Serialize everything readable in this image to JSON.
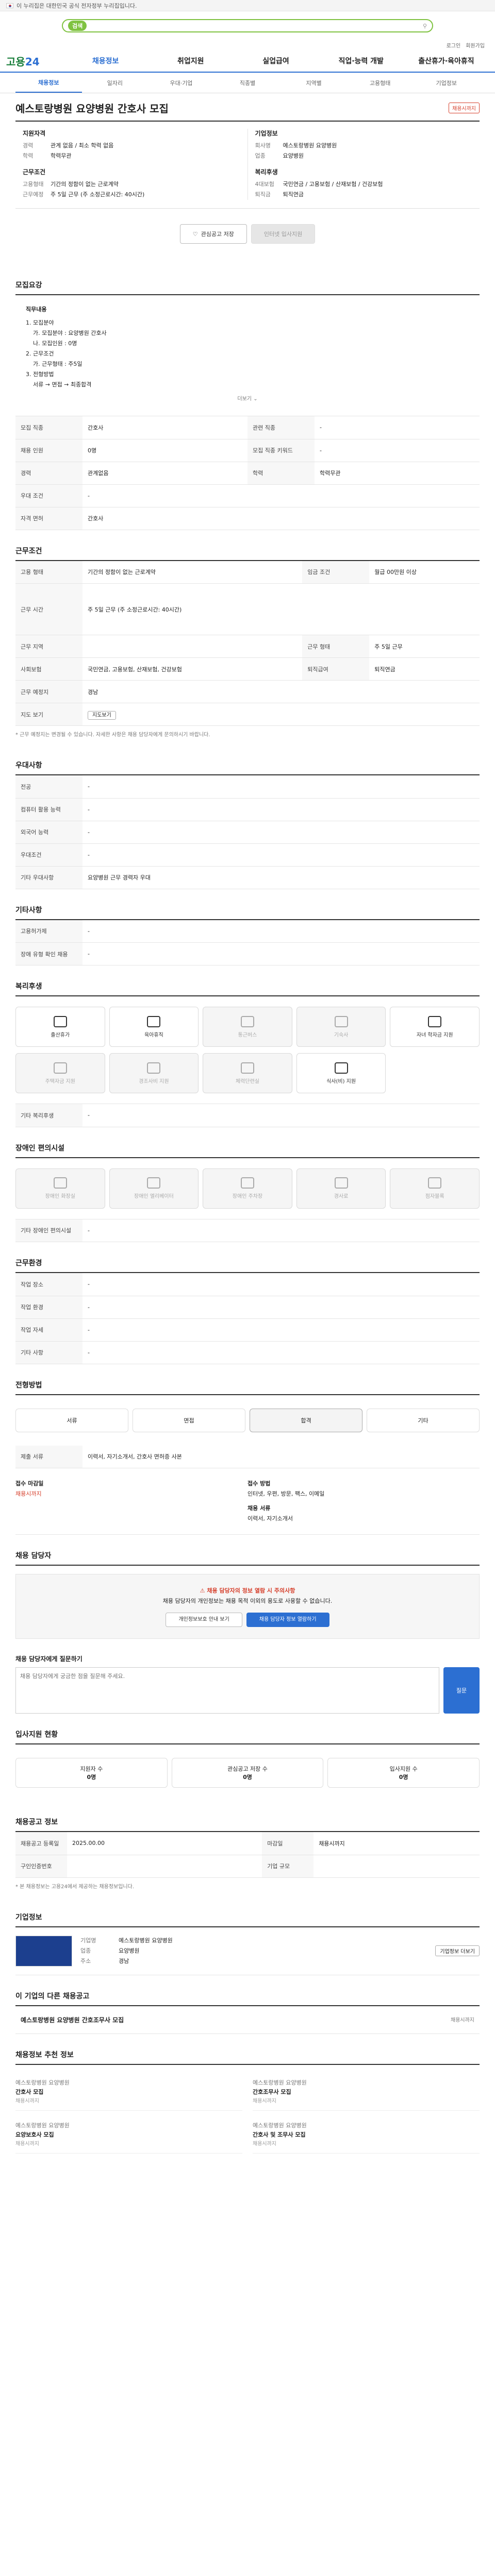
{
  "govbar": {
    "text": "이 누리집은 대한민국 공식 전자정부 누리집입니다."
  },
  "search": {
    "label": "검색",
    "placeholder": ""
  },
  "util": [
    "로그인",
    "회원가입"
  ],
  "gnb": {
    "logo_a": "고용",
    "logo_b": "24",
    "items": [
      "채용정보",
      "취업지원",
      "실업급여",
      "직업·능력 개발",
      "출산휴가·육아휴직"
    ]
  },
  "subnav": [
    "채용정보",
    "일자리",
    "우대·기업",
    "직종별",
    "지역별",
    "고용형태",
    "기업정보"
  ],
  "job": {
    "title": "예스토랑병원 요양병원 간호사 모집",
    "status": "채용시까지"
  },
  "summary": {
    "col1": {
      "h1": "지원자격",
      "kv1": [
        [
          "경력",
          "관계 없음 / 최소 학력 없음"
        ],
        [
          "학력",
          "학력무관"
        ]
      ],
      "h2": "근무조건",
      "kv2": [
        [
          "고용형태",
          "기간의 정함이 없는 근로계약"
        ],
        [
          "근무예정",
          "주 5일 근무 (주 소정근로시간: 40시간)"
        ]
      ]
    },
    "col2": {
      "h1": "기업정보",
      "kv1": [
        [
          "회사명",
          "예스토랑병원 요양병원"
        ],
        [
          "업종",
          "요양병원"
        ],
        [
          "기업규모",
          ""
        ]
      ],
      "h2": "복리후생",
      "kv2": [
        [
          "4대보험",
          "국민연금 / 고용보험 / 산재보험 / 건강보험"
        ],
        [
          "퇴직금",
          "퇴직연금"
        ]
      ]
    }
  },
  "actions": {
    "scrap": "관심공고 저장",
    "apply": "인터넷 입사지원"
  },
  "sections": {
    "duty": {
      "title": "모집요강",
      "heading": "직무내용",
      "lines": [
        "1. 모집분야",
        "가. 모집분야 : 요양병원 간호사",
        "나. 모집인원 : 0명",
        "2. 근무조건",
        "가. 근무형태 : 주5일",
        "3. 전형방법",
        "서류 → 면접 → 최종합격"
      ],
      "more": "더보기"
    },
    "recruit": {
      "rows": [
        [
          "모집 직종",
          "간호사",
          "관련 직종",
          "-"
        ],
        [
          "채용 인원",
          "0명",
          "모집 직종 키워드",
          "-"
        ],
        [
          "경력",
          "관계없음",
          "학력",
          "학력무관"
        ],
        [
          "우대 조건",
          "-",
          "",
          ""
        ],
        [
          "자격 면허",
          "간호사",
          "",
          ""
        ]
      ]
    },
    "work": {
      "title": "근무조건",
      "rows": [
        [
          "고용 형태",
          "기간의 정함이 없는 근로계약",
          "임금 조건",
          "월급 00만원 이상"
        ],
        [
          "근무 시간",
          "주 5일 근무 (주 소정근로시간: 40시간)",
          "",
          ""
        ],
        [
          "근무 지역",
          "",
          "근무 형태",
          "주 5일 근무"
        ],
        [
          "사회보험",
          "국민연금, 고용보험, 산재보험, 건강보험",
          "퇴직급여",
          "퇴직연금"
        ],
        [
          "근무 예정지",
          "경남",
          "",
          ""
        ],
        [
          "지도 보기",
          "지도보기",
          "",
          ""
        ]
      ],
      "note": "* 근무 예정지는 변경될 수 있습니다. 자세한 사항은 채용 담당자에게 문의하시기 바랍니다."
    },
    "welfare": {
      "title": "우대사항",
      "rows": [
        [
          "전공",
          "-"
        ],
        [
          "컴퓨터 활용 능력",
          "-"
        ],
        [
          "외국어 능력",
          "-"
        ],
        [
          "우대조건",
          "-"
        ],
        [
          "기타 우대사항",
          "요양병원 근무 경력자 우대"
        ]
      ]
    },
    "etc": {
      "title": "기타사항",
      "rows": [
        [
          "고용허가제",
          "-"
        ],
        [
          "장애 유형 확인 채용",
          "-"
        ]
      ]
    },
    "benefits": {
      "title": "복리후생",
      "cards": [
        [
          "출산휴가",
          true
        ],
        [
          "육아휴직",
          true
        ],
        [
          "통근버스",
          false
        ],
        [
          "기숙사",
          false
        ],
        [
          "자녀 학자금 지원",
          true
        ],
        [
          "주택자금 지원",
          false
        ],
        [
          "경조사비 지원",
          false
        ],
        [
          "체력단련실",
          false
        ],
        [
          "식사(비) 지원",
          true
        ]
      ],
      "etc_label": "기타 복리후생",
      "etc_value": "-"
    },
    "disabled": {
      "title": "장애인 편의시설",
      "cards": [
        "장애인 화장실",
        "장애인 엘리베이터",
        "장애인 주차장",
        "경사로",
        "점자블록"
      ],
      "etc_label": "기타 장애인 편의시설",
      "etc_value": "-"
    },
    "location": {
      "title": "근무환경",
      "rows": [
        [
          "작업 장소",
          "-",
          "",
          ""
        ],
        [
          "작업 환경",
          "-",
          "",
          ""
        ],
        [
          "작업 자세",
          "-",
          "",
          ""
        ],
        [
          "기타 사항",
          "-",
          "",
          ""
        ]
      ]
    },
    "process": {
      "title": "전형방법",
      "steps": [
        "서류",
        "면접",
        "합격",
        "기타"
      ],
      "on": 2,
      "docs_label": "제출 서류",
      "docs": "이력서, 자기소개서, 간호사 면허증 사본"
    },
    "apply": {
      "c1_h": "접수 마감일",
      "c1_v": "채용시까지",
      "c2_h": "접수 방법",
      "c2_v": "인터넷, 우편, 방문, 팩스, 이메일",
      "c3_h": "채용 서류",
      "c3_v": "이력서, 자기소개서"
    },
    "contact": {
      "title": "채용 담당자",
      "warn": "채용 담당자의 정보 열람 시 주의사항",
      "line1": "채용 담당자의 개인정보는 채용 목적 이외의 용도로 사용할 수 없습니다.",
      "b1": "개인정보보호 안내 보기",
      "b2": "채용 담당자 정보 열람하기"
    },
    "inquiry": {
      "title": "채용 담당자에게 질문하기",
      "placeholder": "채용 담당자에게 궁금한 점을 질문해 주세요.",
      "btn": "질문"
    },
    "status": {
      "title": "입사지원 현황",
      "items": [
        [
          "지원자 수",
          "0명"
        ],
        [
          "관심공고 저장 수",
          "0명"
        ],
        [
          "입사지원 수",
          "0명"
        ]
      ]
    },
    "info": {
      "title": "채용공고 정보",
      "rows": [
        [
          "채용공고 등록일",
          "2025.00.00",
          "마감일",
          "채용시까지"
        ],
        [
          "구인인증번호",
          "",
          "기업 규모",
          ""
        ]
      ],
      "note": "* 본 채용정보는 고용24에서 제공하는 채용정보입니다."
    },
    "company": {
      "title": "기업정보",
      "rows": [
        [
          "기업명",
          "예스토랑병원 요양병원"
        ],
        [
          "업종",
          "요양병원"
        ],
        [
          "주소",
          "경남"
        ]
      ],
      "btn": "기업정보 더보기"
    },
    "related": {
      "title": "이 기업의 다른 채용공고",
      "job": "예스토랑병원 요양병원 간호조무사 모집",
      "meta": "채용시까지"
    },
    "recommend": {
      "title": "채용정보 추천 정보",
      "cards": [
        [
          "예스토랑병원 요양병원",
          "간호사 모집",
          "채용시까지"
        ],
        [
          "예스토랑병원 요양병원",
          "간호조무사 모집",
          "채용시까지"
        ],
        [
          "예스토랑병원 요양병원",
          "요양보호사 모집",
          "채용시까지"
        ],
        [
          "예스토랑병원 요양병원",
          "간호사 및 조무사 모집",
          "채용시까지"
        ]
      ]
    }
  }
}
